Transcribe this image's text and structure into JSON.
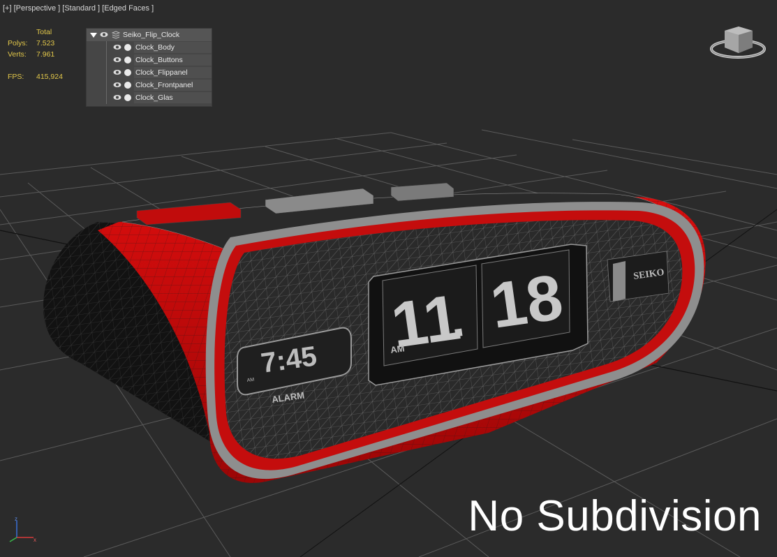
{
  "viewport": {
    "label": "[+] [Perspective ] [Standard ] [Edged Faces ]"
  },
  "stats": {
    "total_label": "Total",
    "polys_label": "Polys:",
    "polys_value": "7.523",
    "verts_label": "Verts:",
    "verts_value": "7.961",
    "fps_label": "FPS:",
    "fps_value": "415,924"
  },
  "scene_explorer": {
    "root": "Seiko_Flip_Clock",
    "children": [
      "Clock_Body",
      "Clock_Buttons",
      "Clock_Flippanel",
      "Clock_Frontpanel",
      "Clock_Glas"
    ]
  },
  "model": {
    "time_hours": "11",
    "time_minutes": "18",
    "time_separator": ".",
    "am_label": "AM",
    "alarm_time": "7:45",
    "alarm_am": "AM",
    "alarm_label": "ALARM",
    "brand": "SEIKO"
  },
  "caption": "No Subdivision",
  "axis": {
    "x": "x",
    "z": "z"
  },
  "colors": {
    "background": "#2b2b2b",
    "grid": "#5a5a5a",
    "body_red": "#c80a0a",
    "wire": "#d0d0d0",
    "stats_yellow": "#e3c84a"
  }
}
